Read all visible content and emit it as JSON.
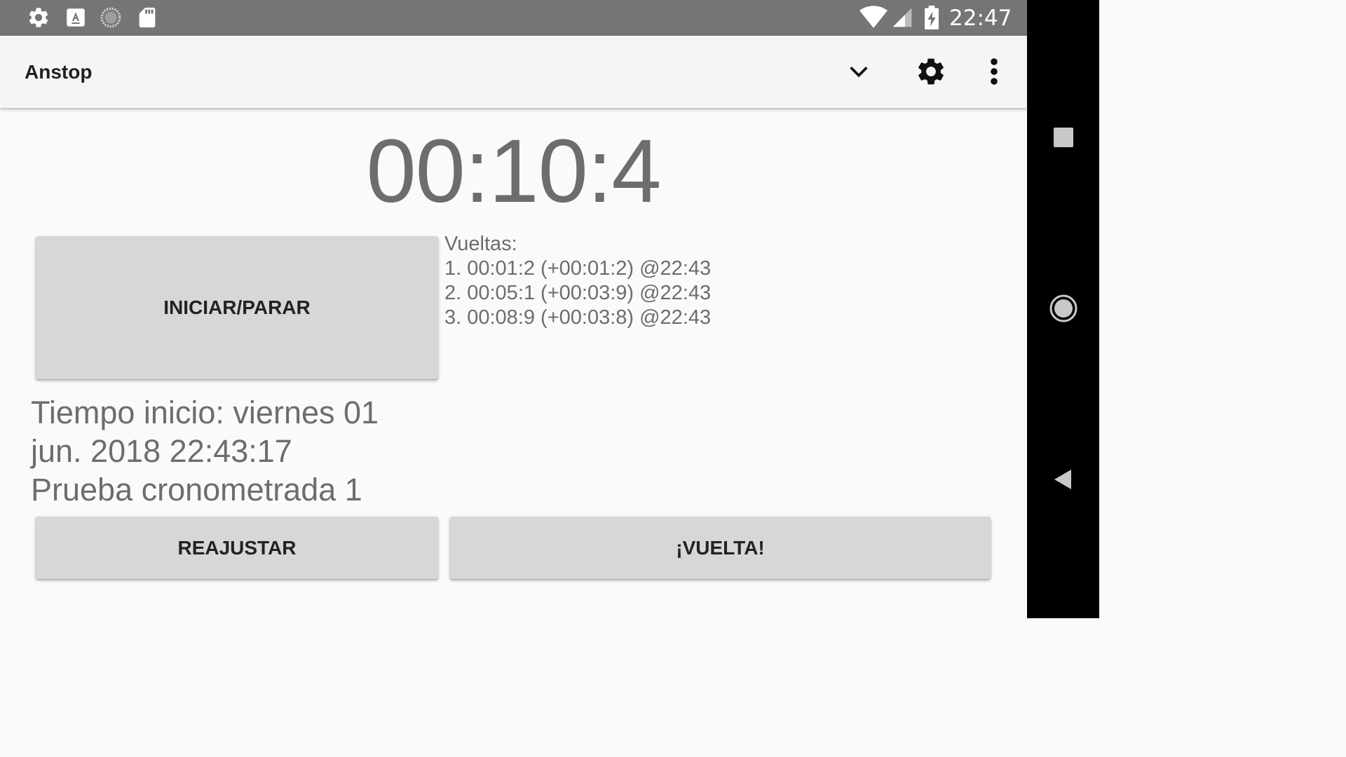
{
  "status_bar": {
    "time": "22:47",
    "left_icons": [
      "gear-icon",
      "text-a-icon",
      "loading-circle-icon",
      "sd-card-icon"
    ],
    "right_icons": [
      "wifi-icon",
      "cell-signal-icon",
      "battery-charging-icon"
    ]
  },
  "toolbar": {
    "title": "Anstop",
    "actions": [
      "chevron-down-icon",
      "settings-gear-icon",
      "more-vert-icon"
    ]
  },
  "timer": {
    "display": "00:10:4"
  },
  "buttons": {
    "start_stop": "INICIAR/PARAR",
    "reset": "REAJUSTAR",
    "lap": "¡VUELTA!"
  },
  "laps": {
    "header": "Vueltas:",
    "items": [
      "1. 00:01:2 (+00:01:2) @22:43",
      "2. 00:05:1 (+00:03:9) @22:43",
      "3. 00:08:9 (+00:03:8) @22:43"
    ]
  },
  "start_info": {
    "line1": "Tiempo inicio: viernes 01",
    "line2": "jun. 2018 22:43:17",
    "line3": "Prueba cronometrada 1"
  },
  "nav_bar": {
    "buttons": [
      "recents-square-icon",
      "home-circle-icon",
      "back-triangle-icon"
    ]
  },
  "colors": {
    "status_bar": "#757575",
    "toolbar": "#f5f5f5",
    "background": "#fafafa",
    "button": "#d6d7d7",
    "text_secondary": "#6d6d6d",
    "nav_bar": "#000000"
  }
}
